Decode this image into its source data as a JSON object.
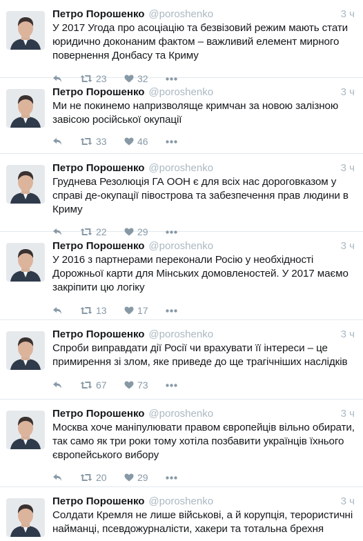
{
  "colors": {
    "name": "#14171a",
    "muted": "#aab8c2",
    "action_icon": "#8899a6",
    "divider": "#e1e8ed"
  },
  "icons": {
    "reply": "reply-icon",
    "retweet": "retweet-icon",
    "like": "heart-icon",
    "more": "more-dots-icon"
  },
  "tweets": [
    {
      "name": "Петро Порошенко",
      "handle": "@poroshenko",
      "time": "3 ч",
      "text": "У 2017 Угода про асоціацію та безвізовий режим мають стати юридично доконаним фактом – важливий елемент мирного повернення Донбасу та Криму",
      "retweets": "23",
      "likes": "32"
    },
    {
      "name": "Петро Порошенко",
      "handle": "@poroshenko",
      "time": "3 ч",
      "text": "Ми не покинемо напризволяще кримчан за новою залізною завісою російської окупації",
      "retweets": "33",
      "likes": "46"
    },
    {
      "name": "Петро Порошенко",
      "handle": "@poroshenko",
      "time": "3 ч",
      "text": "Груднева Резолюція ГА ООН є для всіх нас дороговказом у справі де-окупації півострова та забезпечення прав людини в Криму",
      "retweets": "22",
      "likes": "29"
    },
    {
      "name": "Петро Порошенко",
      "handle": "@poroshenko",
      "time": "3 ч",
      "text": "У 2016 з партнерами переконали Росію у необхідності Дорожньої карти для Мінських домовленостей. У 2017 маємо закріпити цю логіку",
      "retweets": "13",
      "likes": "17"
    },
    {
      "name": "Петро Порошенко",
      "handle": "@poroshenko",
      "time": "3 ч",
      "text": "Спроби виправдати дії Росії чи врахувати її інтереси – це примирення зі злом, яке приведе до ще трагічніших наслідків",
      "retweets": "67",
      "likes": "73"
    },
    {
      "name": "Петро Порошенко",
      "handle": "@poroshenko",
      "time": "3 ч",
      "text": "Москва хоче маніпулювати правом європейців вільно обирати, так само як три роки тому хотіла позбавити українців їхнього європейського вибору",
      "retweets": "20",
      "likes": "29"
    },
    {
      "name": "Петро Порошенко",
      "handle": "@poroshenko",
      "time": "3 ч",
      "text": "Солдати Кремля не лише військові, а й корупція, терористичні найманці, псевдожурналісти, хакери та тотальна брехня",
      "retweets": "",
      "likes": ""
    }
  ]
}
